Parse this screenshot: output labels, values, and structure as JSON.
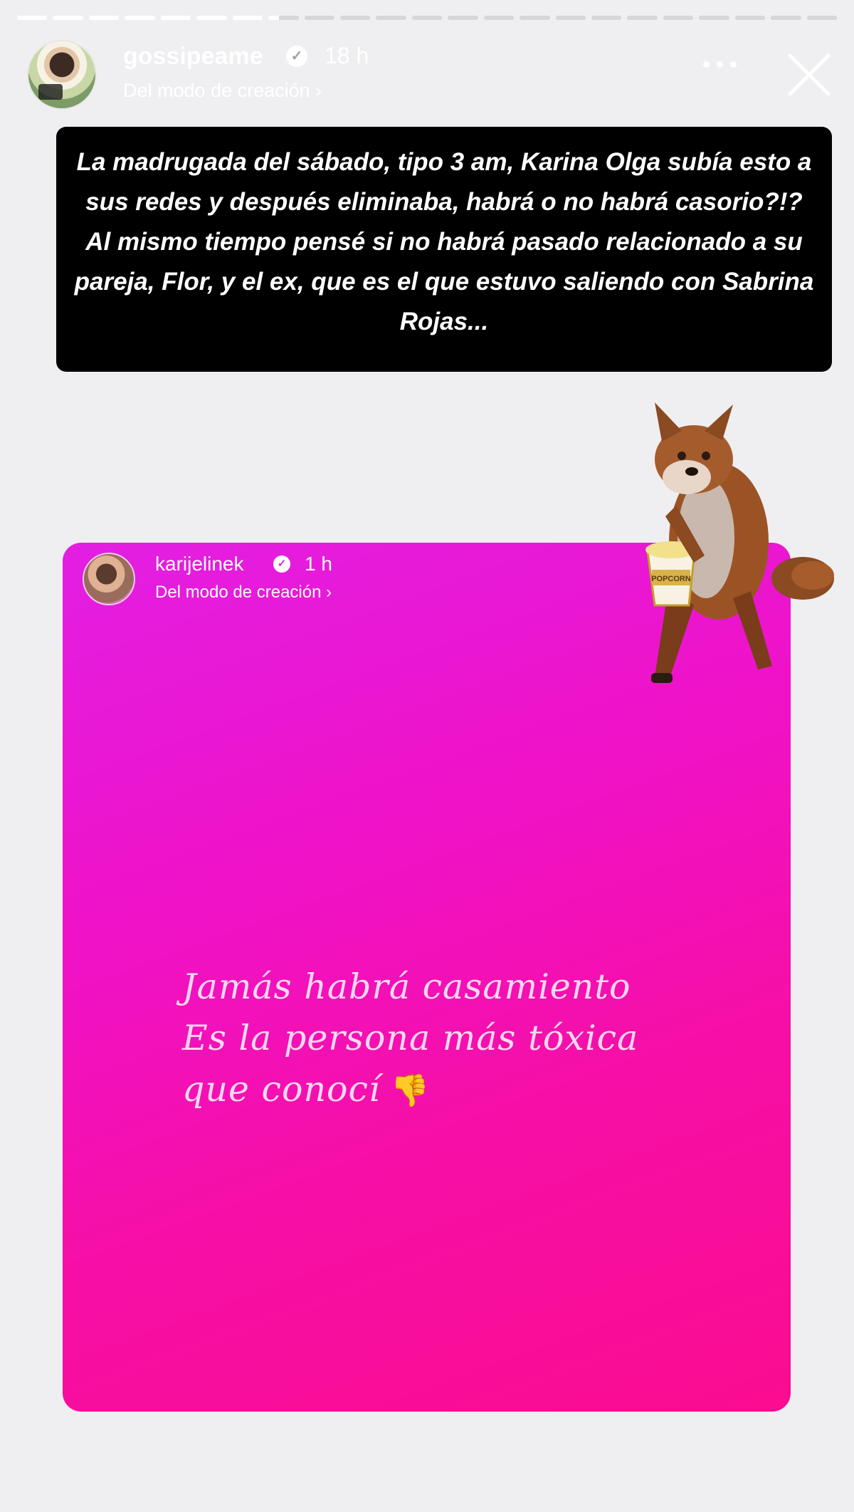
{
  "story": {
    "progress_segments": 23,
    "progress_current_index": 7,
    "progress_current_fraction": 0.35
  },
  "header": {
    "username": "gossipeame",
    "verified_icon": "verified-badge-icon",
    "time": "18 h",
    "subtitle": "Del modo de creación",
    "more_icon": "more-dots-icon",
    "close_icon": "close-icon"
  },
  "caption": {
    "text": "La madrugada del sábado, tipo 3 am, Karina Olga subía esto a sus redes y después eliminaba, habrá o no habrá casorio?!? Al mismo tiempo pensé si no habrá pasado relacionado a su pareja, Flor, y el ex, que es el que estuvo saliendo con Sabrina Rojas..."
  },
  "sticker": {
    "icon": "fox-popcorn-sticker",
    "popcorn_label": "POPCORN"
  },
  "embedded_post": {
    "username": "karijelinek",
    "time": "1 h",
    "subtitle": "Del modo de creación",
    "lines": [
      "Jamás habrá casamiento",
      "Es la persona más tóxica",
      "que conocí"
    ],
    "emoji": "👎",
    "gradient_start": "#e21fe3",
    "gradient_end": "#fb0c90"
  }
}
